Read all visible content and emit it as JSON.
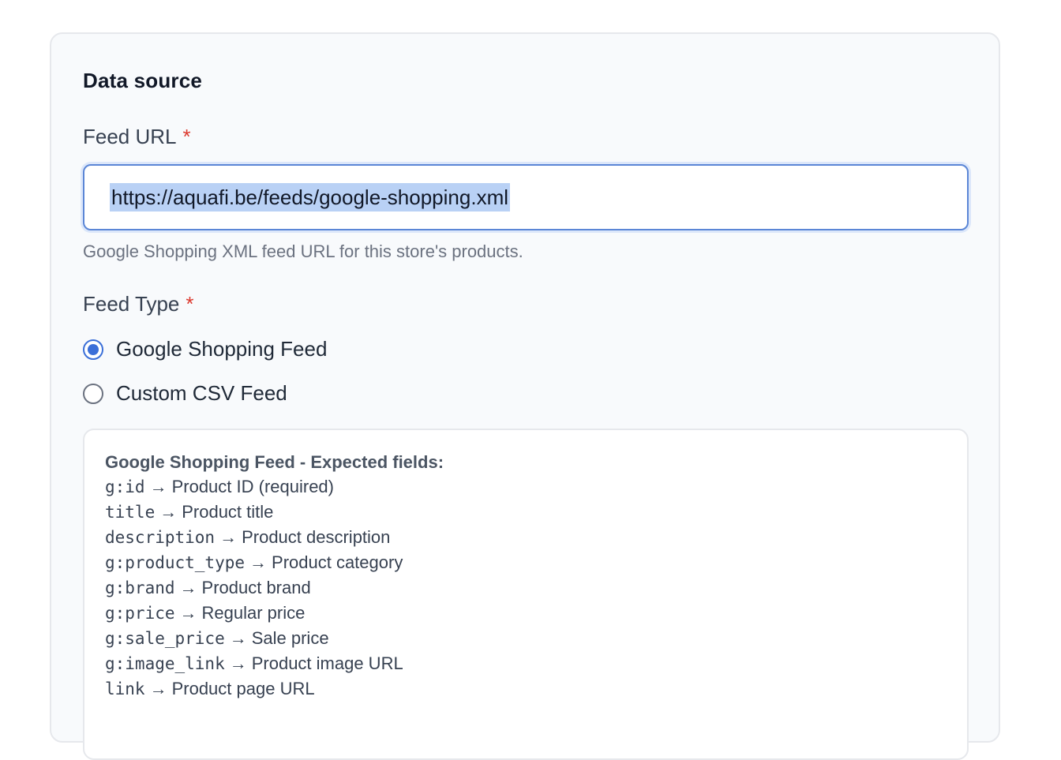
{
  "section": {
    "title": "Data source"
  },
  "feed_url": {
    "label": "Feed URL",
    "required_mark": "*",
    "value": "https://aquafi.be/feeds/google-shopping.xml",
    "help": "Google Shopping XML feed URL for this store's products."
  },
  "feed_type": {
    "label": "Feed Type",
    "required_mark": "*",
    "options": [
      {
        "label": "Google Shopping Feed",
        "selected": true
      },
      {
        "label": "Custom CSV Feed",
        "selected": false
      }
    ]
  },
  "expected_fields": {
    "title": "Google Shopping Feed - Expected fields:",
    "arrow": "→",
    "rows": [
      {
        "field": "g:id",
        "description": "Product ID (required)"
      },
      {
        "field": "title",
        "description": "Product title"
      },
      {
        "field": "description",
        "description": "Product description"
      },
      {
        "field": "g:product_type",
        "description": "Product category"
      },
      {
        "field": "g:brand",
        "description": "Product brand"
      },
      {
        "field": "g:price",
        "description": "Regular price"
      },
      {
        "field": "g:sale_price",
        "description": "Sale price"
      },
      {
        "field": "g:image_link",
        "description": "Product image URL"
      },
      {
        "field": "link",
        "description": "Product page URL"
      }
    ]
  },
  "colors": {
    "accent": "#3b6fd8",
    "required": "#dc3a2f",
    "selection": "#b9d1f5"
  }
}
